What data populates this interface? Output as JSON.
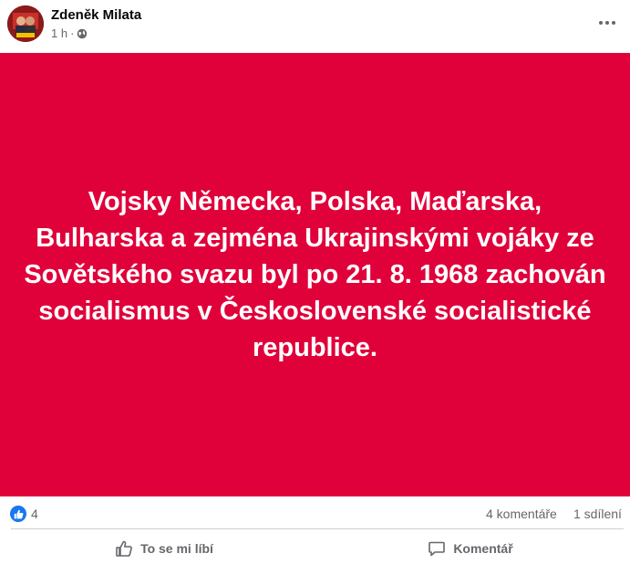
{
  "post": {
    "author": "Zdeněk Milata",
    "time": "1 h",
    "visibility_icon": "globe-icon",
    "background_color": "#e0003a",
    "text": "Vojsky Německa, Polska, Maďarska, Bulharska a zejména Ukrajinskými vojáky ze Sovětského svazu byl po 21. 8. 1968 zachován socialismus v Československé socialistické republice."
  },
  "stats": {
    "reaction_icon": "like-icon",
    "reaction_count": "4",
    "comments": "4 komentáře",
    "shares": "1 sdílení"
  },
  "actions": {
    "like_label": "To se mi líbí",
    "comment_label": "Komentář"
  },
  "colors": {
    "accent": "#1877f2",
    "secondary_text": "#65676b"
  }
}
